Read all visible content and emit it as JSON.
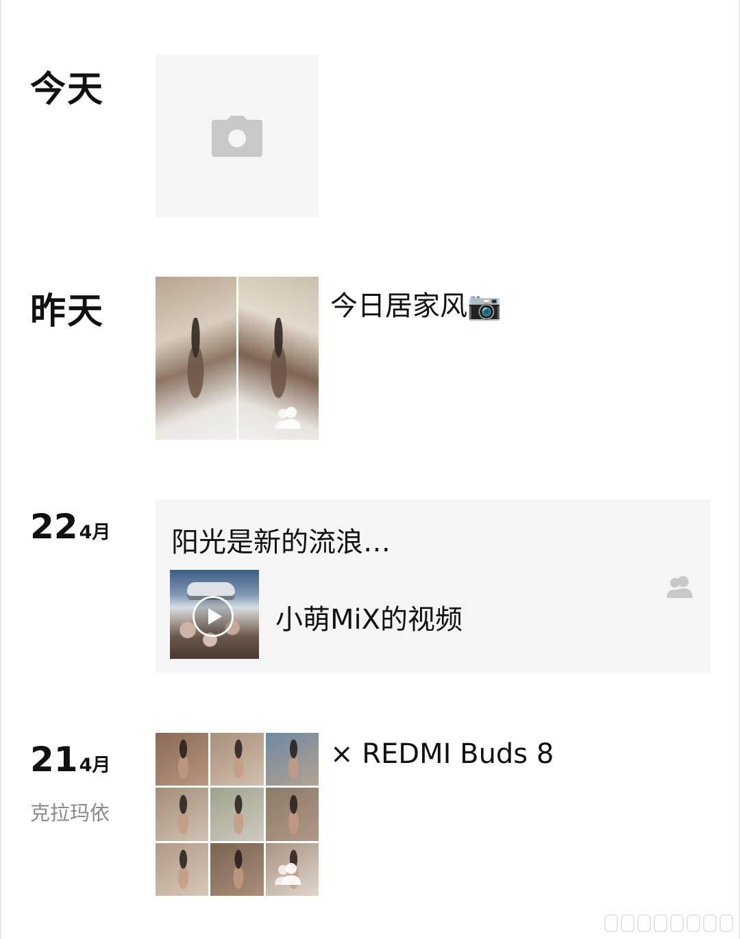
{
  "feed": {
    "today": {
      "date_label": "今天"
    },
    "yesterday": {
      "date_label": "昨天",
      "text": "今日居家风📷"
    },
    "apr22": {
      "day": "22",
      "month": "4月",
      "title": "阳光是新的流浪…",
      "video_label": "小萌MiX的视频"
    },
    "apr21": {
      "day": "21",
      "month": "4月",
      "location": "克拉玛依",
      "text": "× REDMI Buds 8"
    }
  },
  "icons": {
    "camera": "camera-icon",
    "multi_user": "multi-user-icon",
    "play": "play-icon"
  },
  "colors": {
    "placeholder_bg": "#f5f5f5",
    "icon_gray": "#c8c8c8",
    "muted_text": "#8a8a8a"
  }
}
